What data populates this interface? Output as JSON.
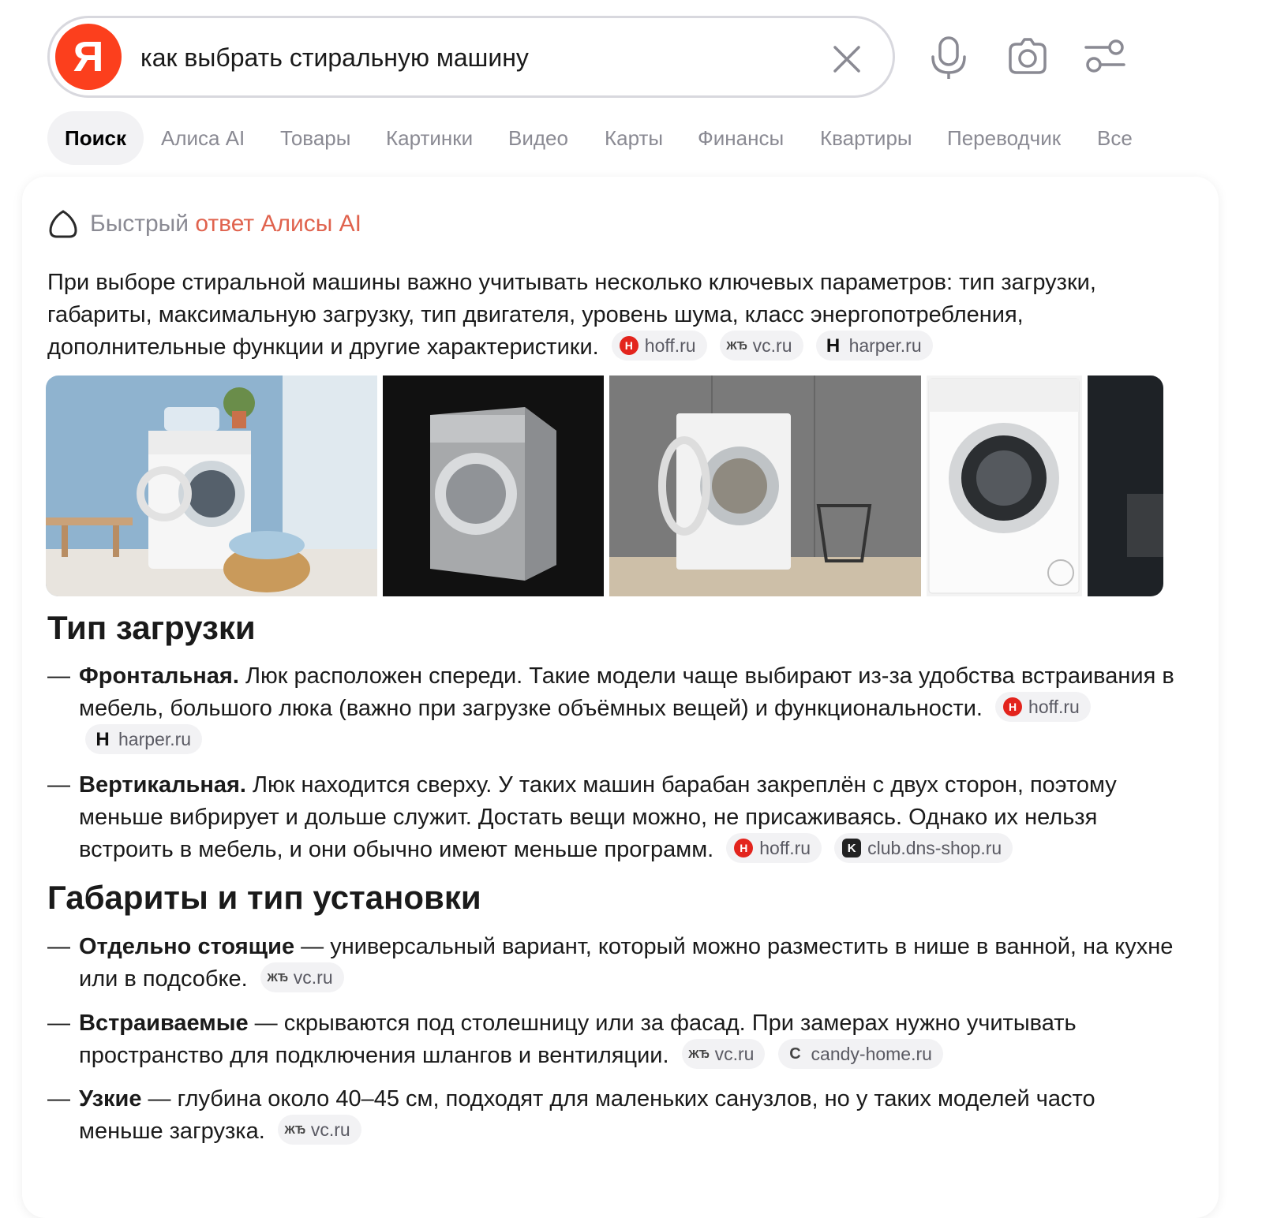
{
  "search": {
    "logo_letter": "Я",
    "query": "как выбрать стиральную машину"
  },
  "tabs": [
    "Поиск",
    "Алиса AI",
    "Товары",
    "Картинки",
    "Видео",
    "Карты",
    "Финансы",
    "Квартиры",
    "Переводчик",
    "Все"
  ],
  "alice": {
    "title_part1": "Быстрый",
    "title_part2": "ответ Алисы AI",
    "intro": "При выборе стиральной машины важно учитывать несколько ключевых параметров: тип загрузки, габариты, максимальную загрузку, тип двигателя, уровень шума, класс энергопотребления, дополнительные функции и другие характеристики.",
    "intro_sources": [
      "hoff.ru",
      "vc.ru",
      "harper.ru"
    ]
  },
  "images": [
    "washing-machine-blue-room",
    "silver-washing-machine-black",
    "open-washing-machine-grey-wall",
    "white-washing-machine-studio",
    "dark-room-partial"
  ],
  "sections": [
    {
      "heading": "Тип загрузки",
      "items": [
        {
          "term": "Фронтальная.",
          "text": " Люк расположен спереди. Такие модели чаще выбирают из-за удобства встраивания в мебель, большого люка (важно при загрузке объёмных вещей) и функциональности.",
          "sources": [
            "hoff.ru",
            "harper.ru"
          ]
        },
        {
          "term": "Вертикальная.",
          "text": " Люк находится сверху. У таких машин барабан закреплён с двух сторон, поэтому меньше вибрирует и дольше служит. Достать вещи можно, не присаживаясь. Однако их нельзя встроить в мебель, и они обычно имеют меньше программ.",
          "sources": [
            "hoff.ru",
            "club.dns-shop.ru"
          ]
        }
      ]
    },
    {
      "heading": "Габариты и тип установки",
      "items": [
        {
          "term": "Отдельно стоящие",
          "text": " — универсальный вариант, который можно разместить в нише в ванной, на кухне или в подсобке.",
          "sources": [
            "vc.ru"
          ]
        },
        {
          "term": "Встраиваемые",
          "text": " — скрываются под столешницу или за фасад. При замерах нужно учитывать пространство для подключения шлангов и вентиляции.",
          "sources": [
            "vc.ru",
            "candy-home.ru"
          ]
        },
        {
          "term": "Узкие",
          "text": " — глубина около 40–45 см, подходят для маленьких санузлов, но у таких моделей часто меньше загрузка.",
          "sources": [
            "vc.ru"
          ]
        }
      ]
    }
  ],
  "colors": {
    "brand": "#fc3f1d",
    "accent": "#e0634e",
    "muted": "#8a8a93"
  }
}
